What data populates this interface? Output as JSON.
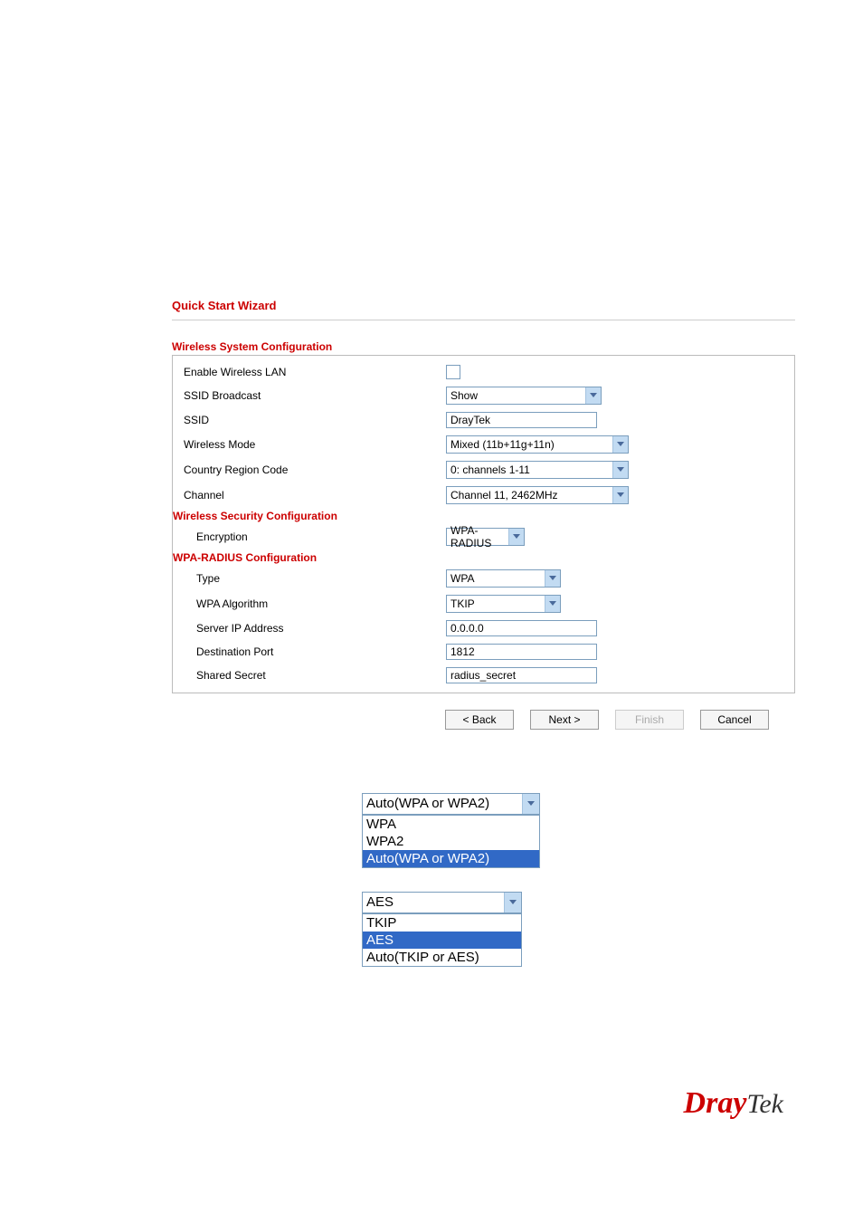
{
  "page_title": "Quick Start Wizard",
  "sections": {
    "system_title": "Wireless System Configuration",
    "security_title": "Wireless Security Configuration",
    "radius_title": "WPA-RADIUS Configuration"
  },
  "labels": {
    "enable_wlan": "Enable Wireless LAN",
    "ssid_broadcast": "SSID Broadcast",
    "ssid": "SSID",
    "wireless_mode": "Wireless Mode",
    "country_region": "Country Region Code",
    "channel": "Channel",
    "encryption": "Encryption",
    "type": "Type",
    "wpa_algorithm": "WPA Algorithm",
    "server_ip": "Server IP Address",
    "dest_port": "Destination Port",
    "shared_secret": "Shared Secret"
  },
  "values": {
    "ssid_broadcast": "Show",
    "ssid": "DrayTek",
    "wireless_mode": "Mixed (11b+11g+11n)",
    "country_region": "0: channels 1-11",
    "channel": "Channel 11, 2462MHz",
    "encryption": "WPA-RADIUS",
    "type": "WPA",
    "wpa_algorithm": "TKIP",
    "server_ip": "0.0.0.0",
    "dest_port": "1812",
    "shared_secret": "radius_secret"
  },
  "buttons": {
    "back": "< Back",
    "next": "Next >",
    "finish": "Finish",
    "cancel": "Cancel"
  },
  "ex1": {
    "selected": "Auto(WPA or WPA2)",
    "options": [
      "WPA",
      "WPA2",
      "Auto(WPA or WPA2)"
    ]
  },
  "ex2": {
    "selected": "AES",
    "options": [
      "TKIP",
      "AES",
      "Auto(TKIP or AES)"
    ]
  },
  "logo": {
    "part1": "Dray",
    "part2": "Tek"
  }
}
